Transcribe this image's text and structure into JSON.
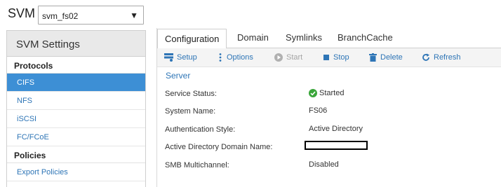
{
  "svm": {
    "label": "SVM",
    "selected": "svm_fs02"
  },
  "sidebar": {
    "title": "SVM Settings",
    "sections": [
      {
        "title": "Protocols",
        "items": [
          "CIFS",
          "NFS",
          "iSCSI",
          "FC/FCoE"
        ]
      },
      {
        "title": "Policies",
        "items": [
          "Export Policies"
        ]
      }
    ],
    "active_item": "CIFS"
  },
  "tabs": [
    "Configuration",
    "Domain",
    "Symlinks",
    "BranchCache"
  ],
  "active_tab": "Configuration",
  "toolbar": {
    "setup": "Setup",
    "options": "Options",
    "start": "Start",
    "stop": "Stop",
    "delete": "Delete",
    "refresh": "Refresh"
  },
  "server": {
    "section_title": "Server",
    "rows": [
      {
        "label": "Service Status:",
        "value": "Started"
      },
      {
        "label": "System Name:",
        "value": "FS06"
      },
      {
        "label": "Authentication Style:",
        "value": "Active Directory"
      },
      {
        "label": "Active Directory Domain Name:",
        "value": ""
      },
      {
        "label": "SMB Multichannel:",
        "value": "Disabled"
      }
    ]
  },
  "colors": {
    "accent": "#2e75b6",
    "active_bg": "#3d8fd5",
    "status_green": "#3aa63a"
  }
}
